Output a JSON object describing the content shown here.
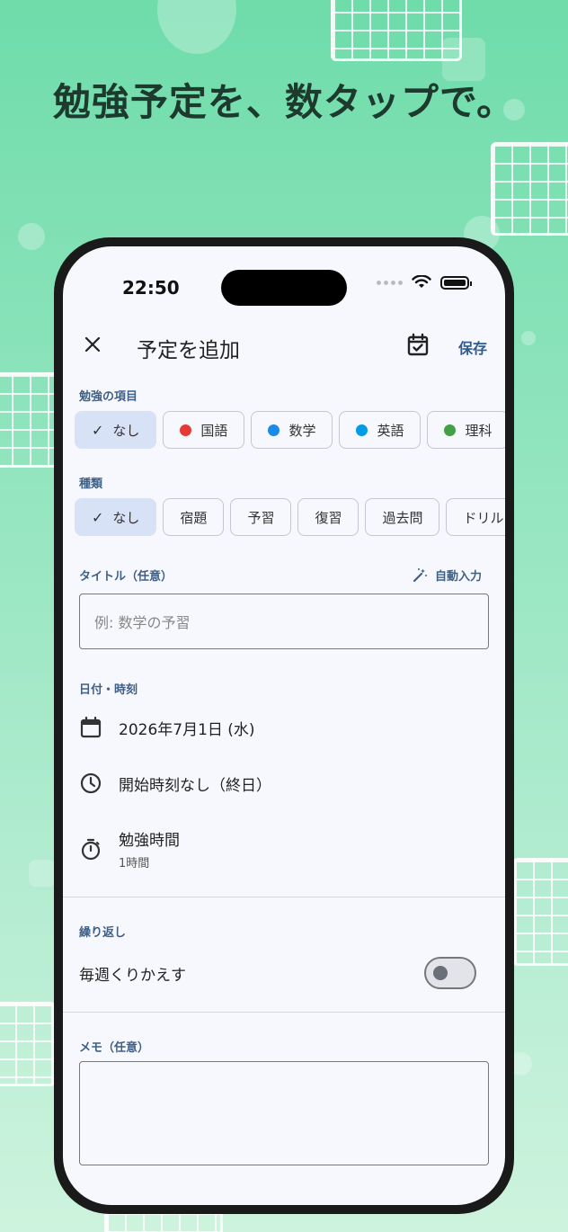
{
  "headline": "勉強予定を、数タップで。",
  "status": {
    "time": "22:50"
  },
  "appbar": {
    "title": "予定を追加",
    "save_label": "保存"
  },
  "subjects": {
    "label": "勉強の項目",
    "items": [
      {
        "label": "なし",
        "selected": true,
        "color": ""
      },
      {
        "label": "国語",
        "selected": false,
        "color": "#e53935"
      },
      {
        "label": "数学",
        "selected": false,
        "color": "#1e88e5"
      },
      {
        "label": "英語",
        "selected": false,
        "color": "#039be5"
      },
      {
        "label": "理科",
        "selected": false,
        "color": "#43a047"
      }
    ]
  },
  "types": {
    "label": "種類",
    "items": [
      {
        "label": "なし",
        "selected": true
      },
      {
        "label": "宿題",
        "selected": false
      },
      {
        "label": "予習",
        "selected": false
      },
      {
        "label": "復習",
        "selected": false
      },
      {
        "label": "過去問",
        "selected": false
      },
      {
        "label": "ドリル",
        "selected": false
      }
    ]
  },
  "title_field": {
    "label": "タイトル（任意）",
    "auto_label": "自動入力",
    "placeholder": "例: 数学の予習"
  },
  "datetime": {
    "label": "日付・時刻",
    "date": "2026年7月1日 (水)",
    "start": "開始時刻なし（終日）",
    "duration_label": "勉強時間",
    "duration_value": "1時間"
  },
  "repeat": {
    "label": "繰り返し",
    "weekly_label": "毎週くりかえす",
    "weekly_on": false
  },
  "memo": {
    "label": "メモ（任意）"
  },
  "colors": {
    "accent": "#2f5a8f",
    "chip_selected": "#d8e2f6",
    "background": "#f7f8fd"
  }
}
